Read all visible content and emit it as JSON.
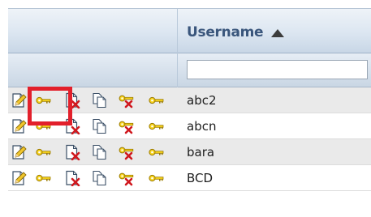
{
  "header": {
    "username_label": "Username"
  },
  "filter": {
    "username_value": ""
  },
  "rows": [
    {
      "username": "abc2"
    },
    {
      "username": "abcn"
    },
    {
      "username": "bara"
    },
    {
      "username": "BCD"
    }
  ],
  "actions": [
    "edit-icon",
    "key-icon",
    "delete-document-icon",
    "copy-icon",
    "delete-key-icon",
    "key-icon"
  ],
  "colors": {
    "highlight": "#e2202b",
    "header_text": "#3a567c",
    "key_gold": "#d4a900",
    "delete_red": "#d0181e"
  }
}
